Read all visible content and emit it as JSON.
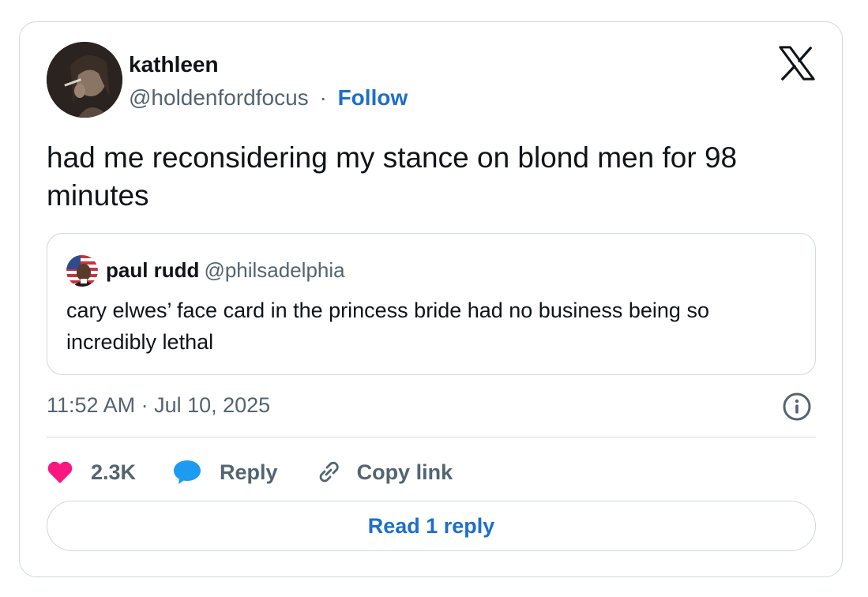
{
  "author": {
    "name": "kathleen",
    "handle": "@holdenfordfocus",
    "separator": "·",
    "follow_label": "Follow"
  },
  "tweet": {
    "text": "had me reconsidering my stance on blond men for 98 minutes",
    "timestamp": "11:52 AM · Jul 10, 2025"
  },
  "quoted": {
    "name": "paul rudd",
    "handle": "@philsadelphia",
    "text": "cary elwes’ face card in the princess bride had no business being so incredibly lethal"
  },
  "actions": {
    "likes": "2.3K",
    "reply_label": "Reply",
    "copy_label": "Copy link",
    "read_replies_label": "Read 1 reply"
  },
  "icons": {
    "logo": "x-logo-icon",
    "like": "heart-icon",
    "reply": "speech-bubble-icon",
    "copy": "link-icon",
    "info": "info-icon"
  },
  "colors": {
    "accent": "#1d6fc9",
    "like": "#f91880",
    "reply": "#1d9bf0",
    "muted": "#536471",
    "border": "#cfd9de"
  }
}
